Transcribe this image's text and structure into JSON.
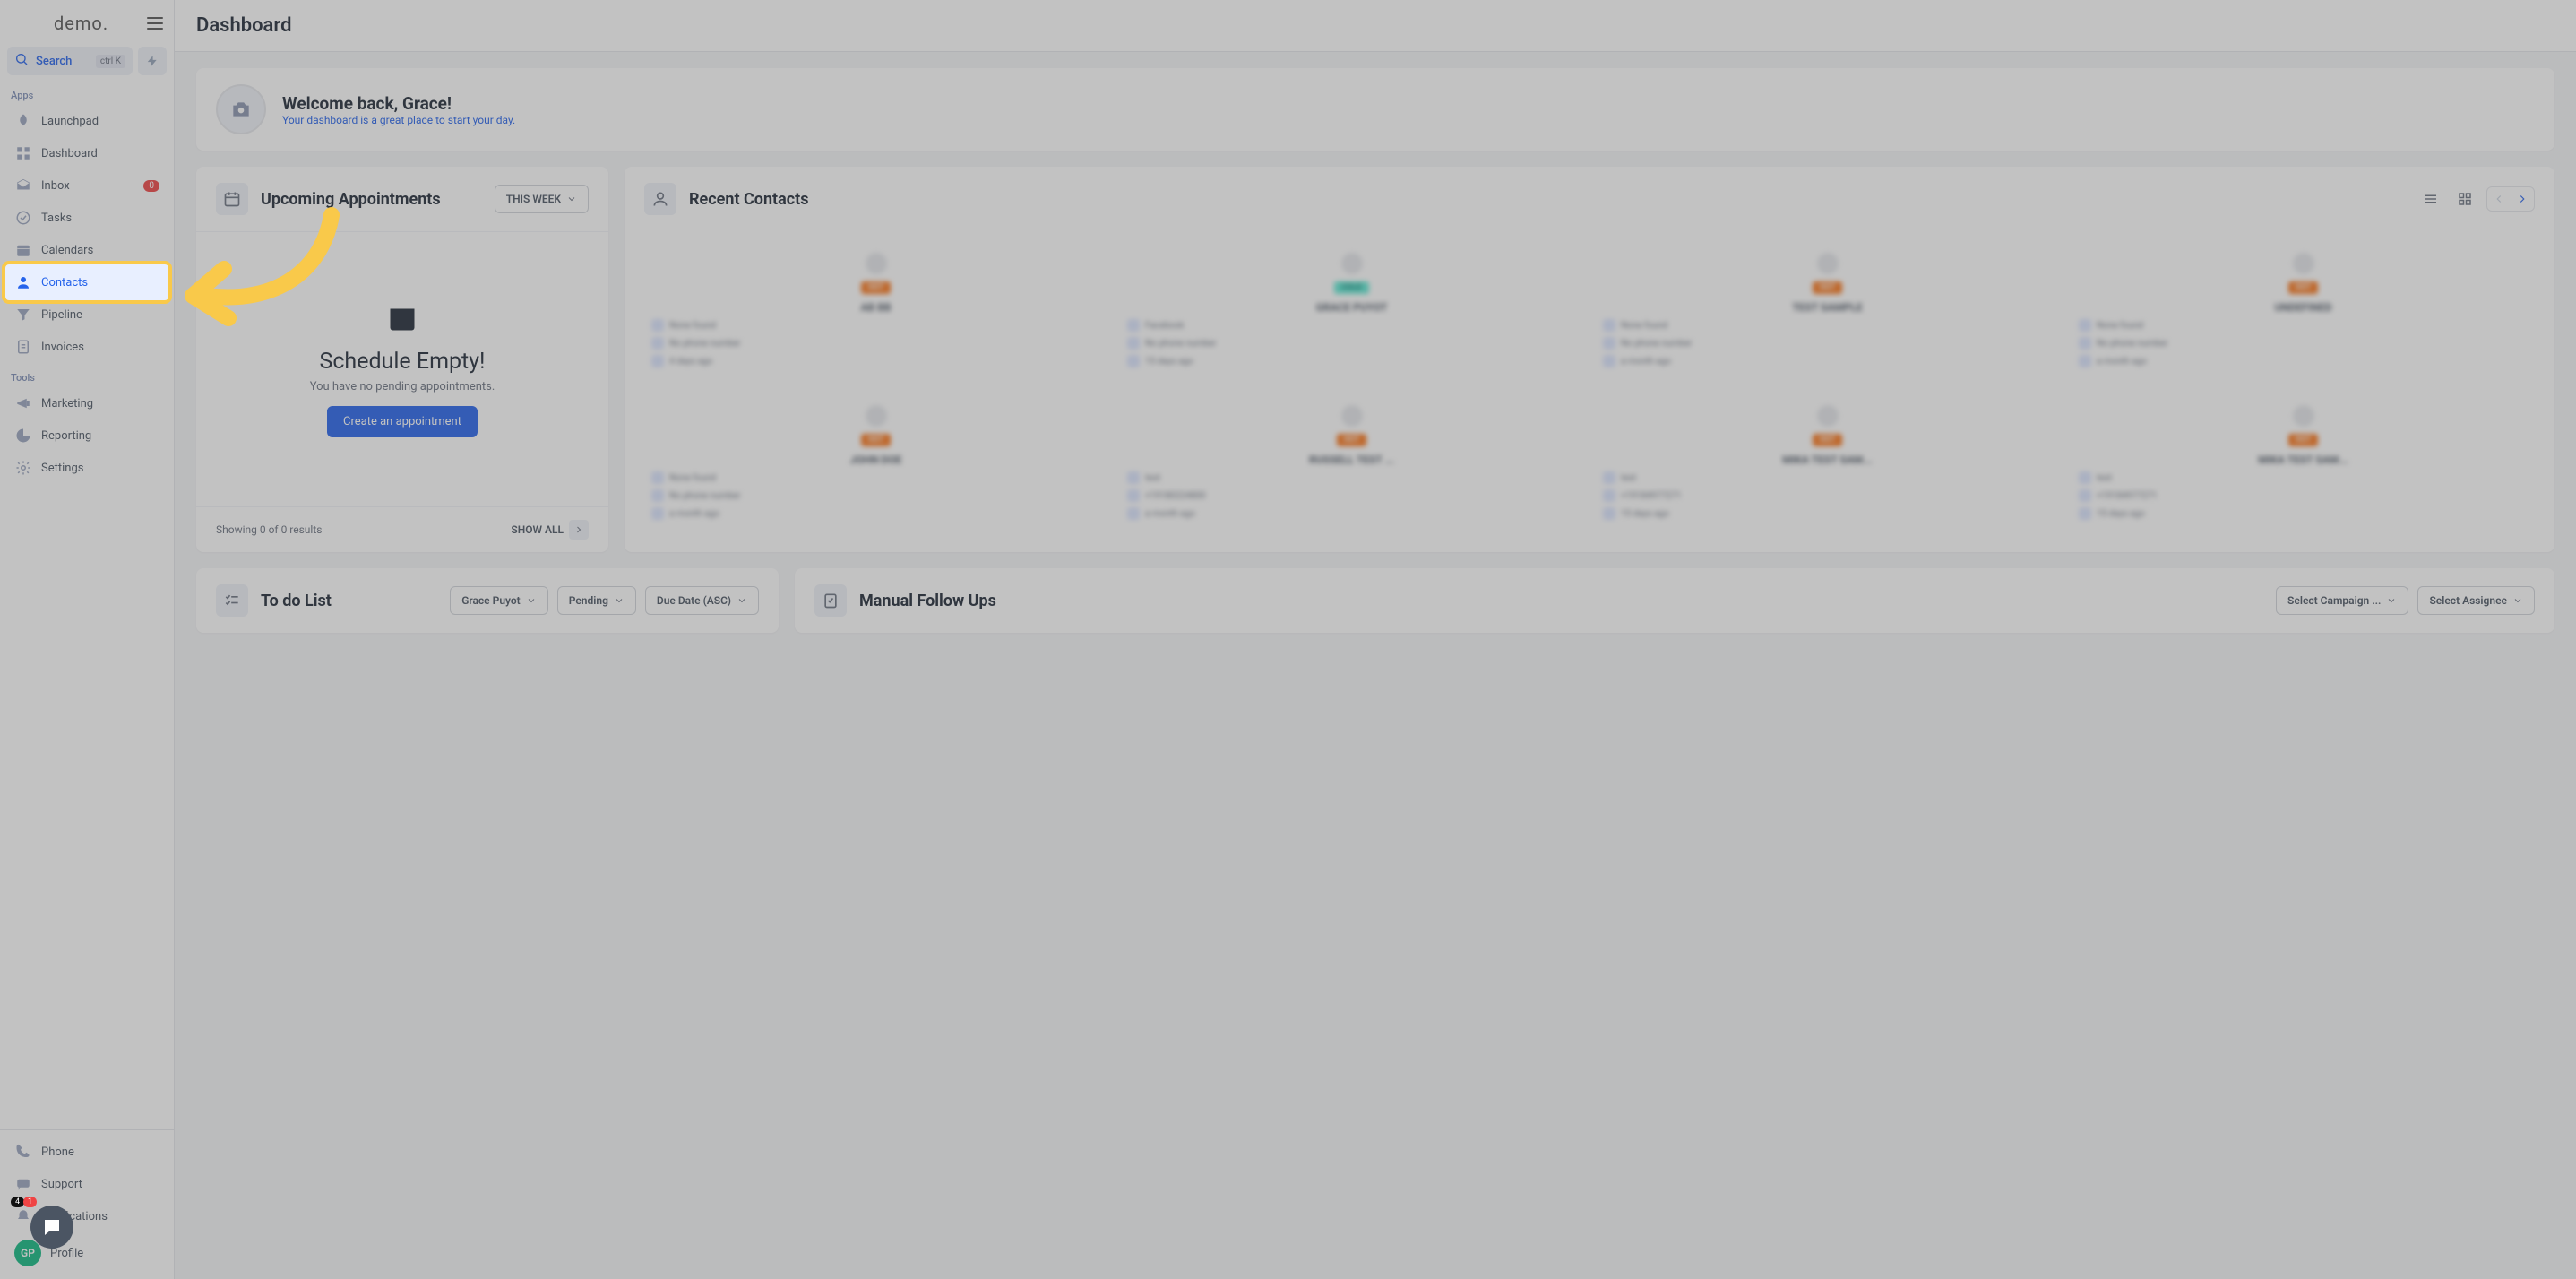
{
  "brand": "demo.",
  "search": {
    "label": "Search",
    "shortcut": "ctrl K"
  },
  "sections": {
    "apps": "Apps",
    "tools": "Tools"
  },
  "nav_apps": [
    {
      "key": "launchpad",
      "label": "Launchpad"
    },
    {
      "key": "dashboard",
      "label": "Dashboard"
    },
    {
      "key": "inbox",
      "label": "Inbox",
      "badge": "0"
    },
    {
      "key": "tasks",
      "label": "Tasks"
    },
    {
      "key": "calendars",
      "label": "Calendars"
    },
    {
      "key": "contacts",
      "label": "Contacts"
    },
    {
      "key": "pipeline",
      "label": "Pipeline"
    },
    {
      "key": "invoices",
      "label": "Invoices"
    }
  ],
  "nav_tools": [
    {
      "key": "marketing",
      "label": "Marketing"
    },
    {
      "key": "reporting",
      "label": "Reporting"
    },
    {
      "key": "settings",
      "label": "Settings"
    }
  ],
  "nav_bottom": [
    {
      "key": "phone",
      "label": "Phone"
    },
    {
      "key": "support",
      "label": "Support"
    },
    {
      "key": "notifications",
      "label": "Notifications",
      "badge_dark": "4",
      "badge_red": "1"
    },
    {
      "key": "profile",
      "label": "Profile",
      "avatar": "GP"
    }
  ],
  "page_title": "Dashboard",
  "welcome": {
    "title": "Welcome back, Grace!",
    "subtitle": "Your dashboard is a great place to start your day."
  },
  "appointments": {
    "title": "Upcoming Appointments",
    "filter": "THIS WEEK",
    "empty_title": "Schedule Empty!",
    "empty_sub": "You have no pending appointments.",
    "cta": "Create an appointment",
    "showing": "Showing 0 of 0 results",
    "show_all": "SHOW ALL"
  },
  "recent_contacts": {
    "title": "Recent Contacts",
    "items": [
      {
        "chip": "HOT",
        "chip_style": "hot",
        "name": "AB BB",
        "l1": "None found",
        "l2": "No phone number",
        "l3": "4 days ago"
      },
      {
        "chip": "COLD",
        "chip_style": "cold",
        "name": "GRACE PUYOT",
        "l1": "Facebook",
        "l2": "No phone number",
        "l3": "15 days ago"
      },
      {
        "chip": "HOT",
        "chip_style": "hot",
        "name": "TEST SAMPLE",
        "l1": "None found",
        "l2": "No phone number",
        "l3": "a month ago"
      },
      {
        "chip": "HOT",
        "chip_style": "hot",
        "name": "UNDEFINED",
        "l1": "None found",
        "l2": "No phone number",
        "l3": "a month ago"
      },
      {
        "chip": "HOT",
        "chip_style": "hot",
        "name": "JOHN DOE",
        "l1": "None found",
        "l2": "No phone number",
        "l3": "a month ago"
      },
      {
        "chip": "HOT",
        "chip_style": "hot",
        "name": "RUSSELL TEST ...",
        "l1": "test",
        "l2": "+19180224800",
        "l3": "a month ago"
      },
      {
        "chip": "HOT",
        "chip_style": "hot",
        "name": "MIKA TEST SAM...",
        "l1": "test",
        "l2": "+19184977271",
        "l3": "15 days ago"
      },
      {
        "chip": "HOT",
        "chip_style": "hot",
        "name": "MIKA TEST SAM...",
        "l1": "test",
        "l2": "+19184977271",
        "l3": "15 days ago"
      }
    ]
  },
  "todo": {
    "title": "To do List",
    "filter_user": "Grace Puyot",
    "filter_status": "Pending",
    "filter_sort": "Due Date (ASC)"
  },
  "followups": {
    "title": "Manual Follow Ups",
    "select_campaign": "Select Campaign ...",
    "select_assignee": "Select Assignee"
  }
}
